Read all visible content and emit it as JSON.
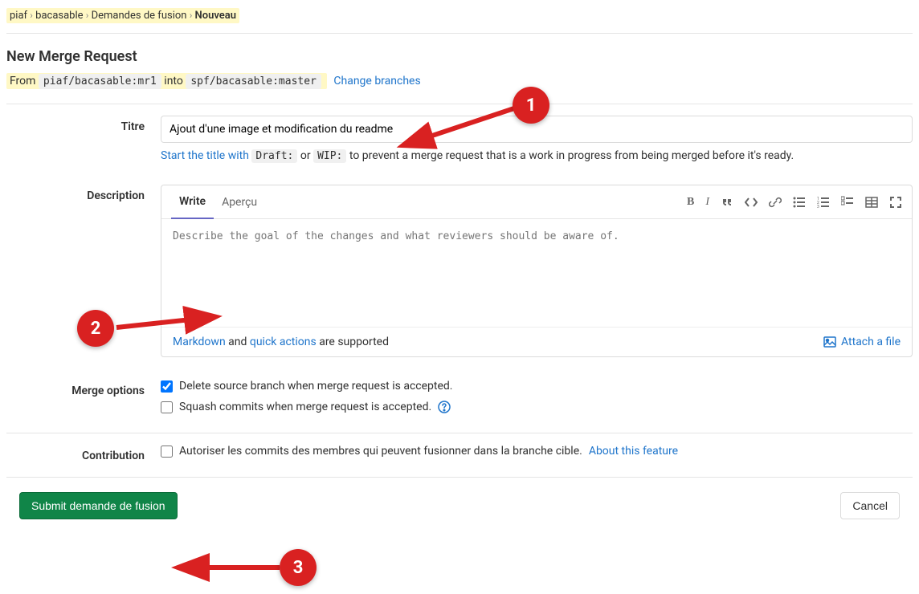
{
  "breadcrumb": {
    "items": [
      "piaf",
      "bacasable",
      "Demandes de fusion",
      "Nouveau"
    ]
  },
  "page": {
    "title": "New Merge Request",
    "from_label": "From",
    "from_branch": "piaf/bacasable:mr1",
    "into_label": "into",
    "into_branch": "spf/bacasable:master",
    "change_branches": "Change branches"
  },
  "form": {
    "title_label": "Titre",
    "title_value": "Ajout d'une image et modification du readme",
    "title_hint_prefix": "Start the title with",
    "title_hint_code1": "Draft:",
    "title_hint_or": "or",
    "title_hint_code2": "WIP:",
    "title_hint_suffix": "to prevent a merge request that is a work in progress from being merged before it's ready.",
    "desc_label": "Description",
    "desc_tab_write": "Write",
    "desc_tab_preview": "Aperçu",
    "desc_placeholder": "Describe the goal of the changes and what reviewers should be aware of.",
    "desc_footer_markdown": "Markdown",
    "desc_footer_and": " and ",
    "desc_footer_quick": "quick actions",
    "desc_footer_suffix": " are supported",
    "desc_attach": "Attach a file",
    "merge_label": "Merge options",
    "merge_opt1": "Delete source branch when merge request is accepted.",
    "merge_opt2": "Squash commits when merge request is accepted.",
    "contrib_label": "Contribution",
    "contrib_text": "Autoriser les commits des membres qui peuvent fusionner dans la branche cible.",
    "contrib_link": "About this feature"
  },
  "actions": {
    "submit": "Submit demande de fusion",
    "cancel": "Cancel"
  },
  "annotations": {
    "m1": "1",
    "m2": "2",
    "m3": "3"
  }
}
